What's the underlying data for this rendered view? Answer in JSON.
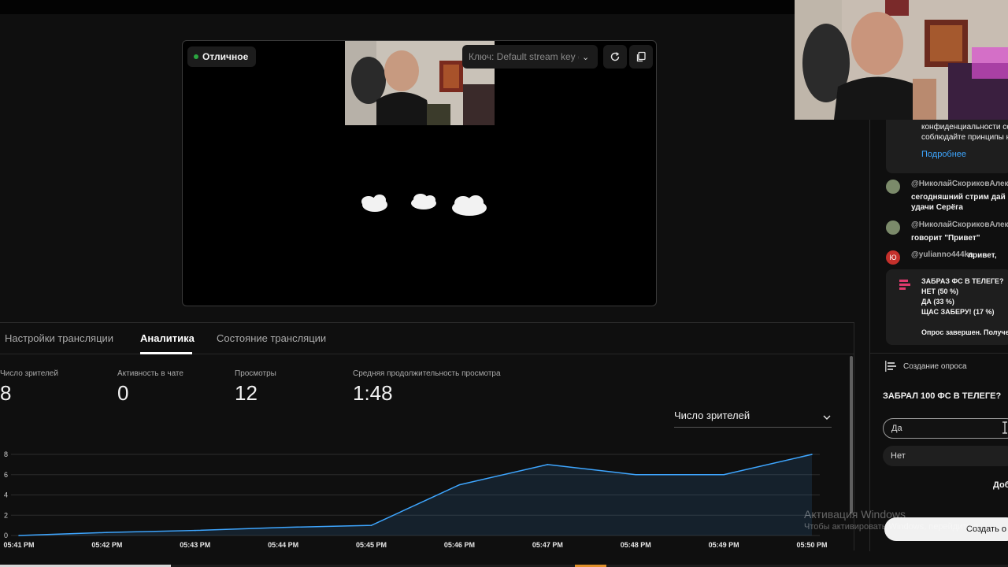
{
  "preview": {
    "status": "Отличное",
    "stream_key": "Ключ: Default stream key (I"
  },
  "tabs": [
    {
      "label": "Настройки трансляции"
    },
    {
      "label": "Аналитика"
    },
    {
      "label": "Состояние трансляции"
    }
  ],
  "metrics": [
    {
      "label": "Число зрителей",
      "value": "8"
    },
    {
      "label": "Активность в чате",
      "value": "0"
    },
    {
      "label": "Просмотры",
      "value": "12"
    },
    {
      "label": "Средняя продолжительность просмотра",
      "value": "1:48"
    }
  ],
  "dropdown": {
    "selected": "Число зрителей"
  },
  "chart_data": {
    "type": "area",
    "x": [
      "05:41 PM",
      "05:42 PM",
      "05:43 PM",
      "05:44 PM",
      "05:45 PM",
      "05:46 PM",
      "05:47 PM",
      "05:48 PM",
      "05:49 PM",
      "05:50 PM"
    ],
    "values": [
      0,
      0.3,
      0.5,
      0.8,
      1,
      5,
      7,
      6,
      6,
      8
    ],
    "yticks": [
      "8",
      "6",
      "4",
      "2",
      "0"
    ],
    "ylim": [
      0,
      8
    ],
    "line_color": "#3ea6ff",
    "grid": true
  },
  "sidebar": {
    "notice": {
      "line1": "конфиденциальности се",
      "line2": "соблюдайте принципы н",
      "link": "Подробнее"
    },
    "chat": [
      {
        "author": "@НиколайСкориковАлек",
        "line1": "сегодняшний стрим дай",
        "line2": "удачи Серёга",
        "avatar_color": "#7b8a6a"
      },
      {
        "author": "@НиколайСкориковАлек",
        "line1": "говорит \"Привет\"",
        "line2": "",
        "avatar_color": "#7b8a6a"
      },
      {
        "author": "@yulianno444ka",
        "line1": "привет,",
        "line2": "",
        "avatar_letter": "Ю",
        "avatar_color": "#c4302b"
      }
    ],
    "poll_result": {
      "question": "ЗАБРАЗ ФС В ТЕЛЕГЕ?",
      "options": [
        "НЕТ (50 %)",
        "ДА (33 %)",
        "ЩАС ЗАБЕРУ! (17 %)"
      ],
      "status": "Опрос завершен. Получе"
    },
    "create_poll_label": "Создание опроса",
    "new_poll_question": "ЗАБРАЛ 100 ФС В ТЕЛЕГЕ?",
    "new_poll_options": [
      "Да",
      "Нет"
    ],
    "add_label": "Доб",
    "create_button": "Создать о"
  },
  "watermark": {
    "line1": "Активация Windows",
    "line2": "Чтобы активировать Windows, перейдите в"
  }
}
